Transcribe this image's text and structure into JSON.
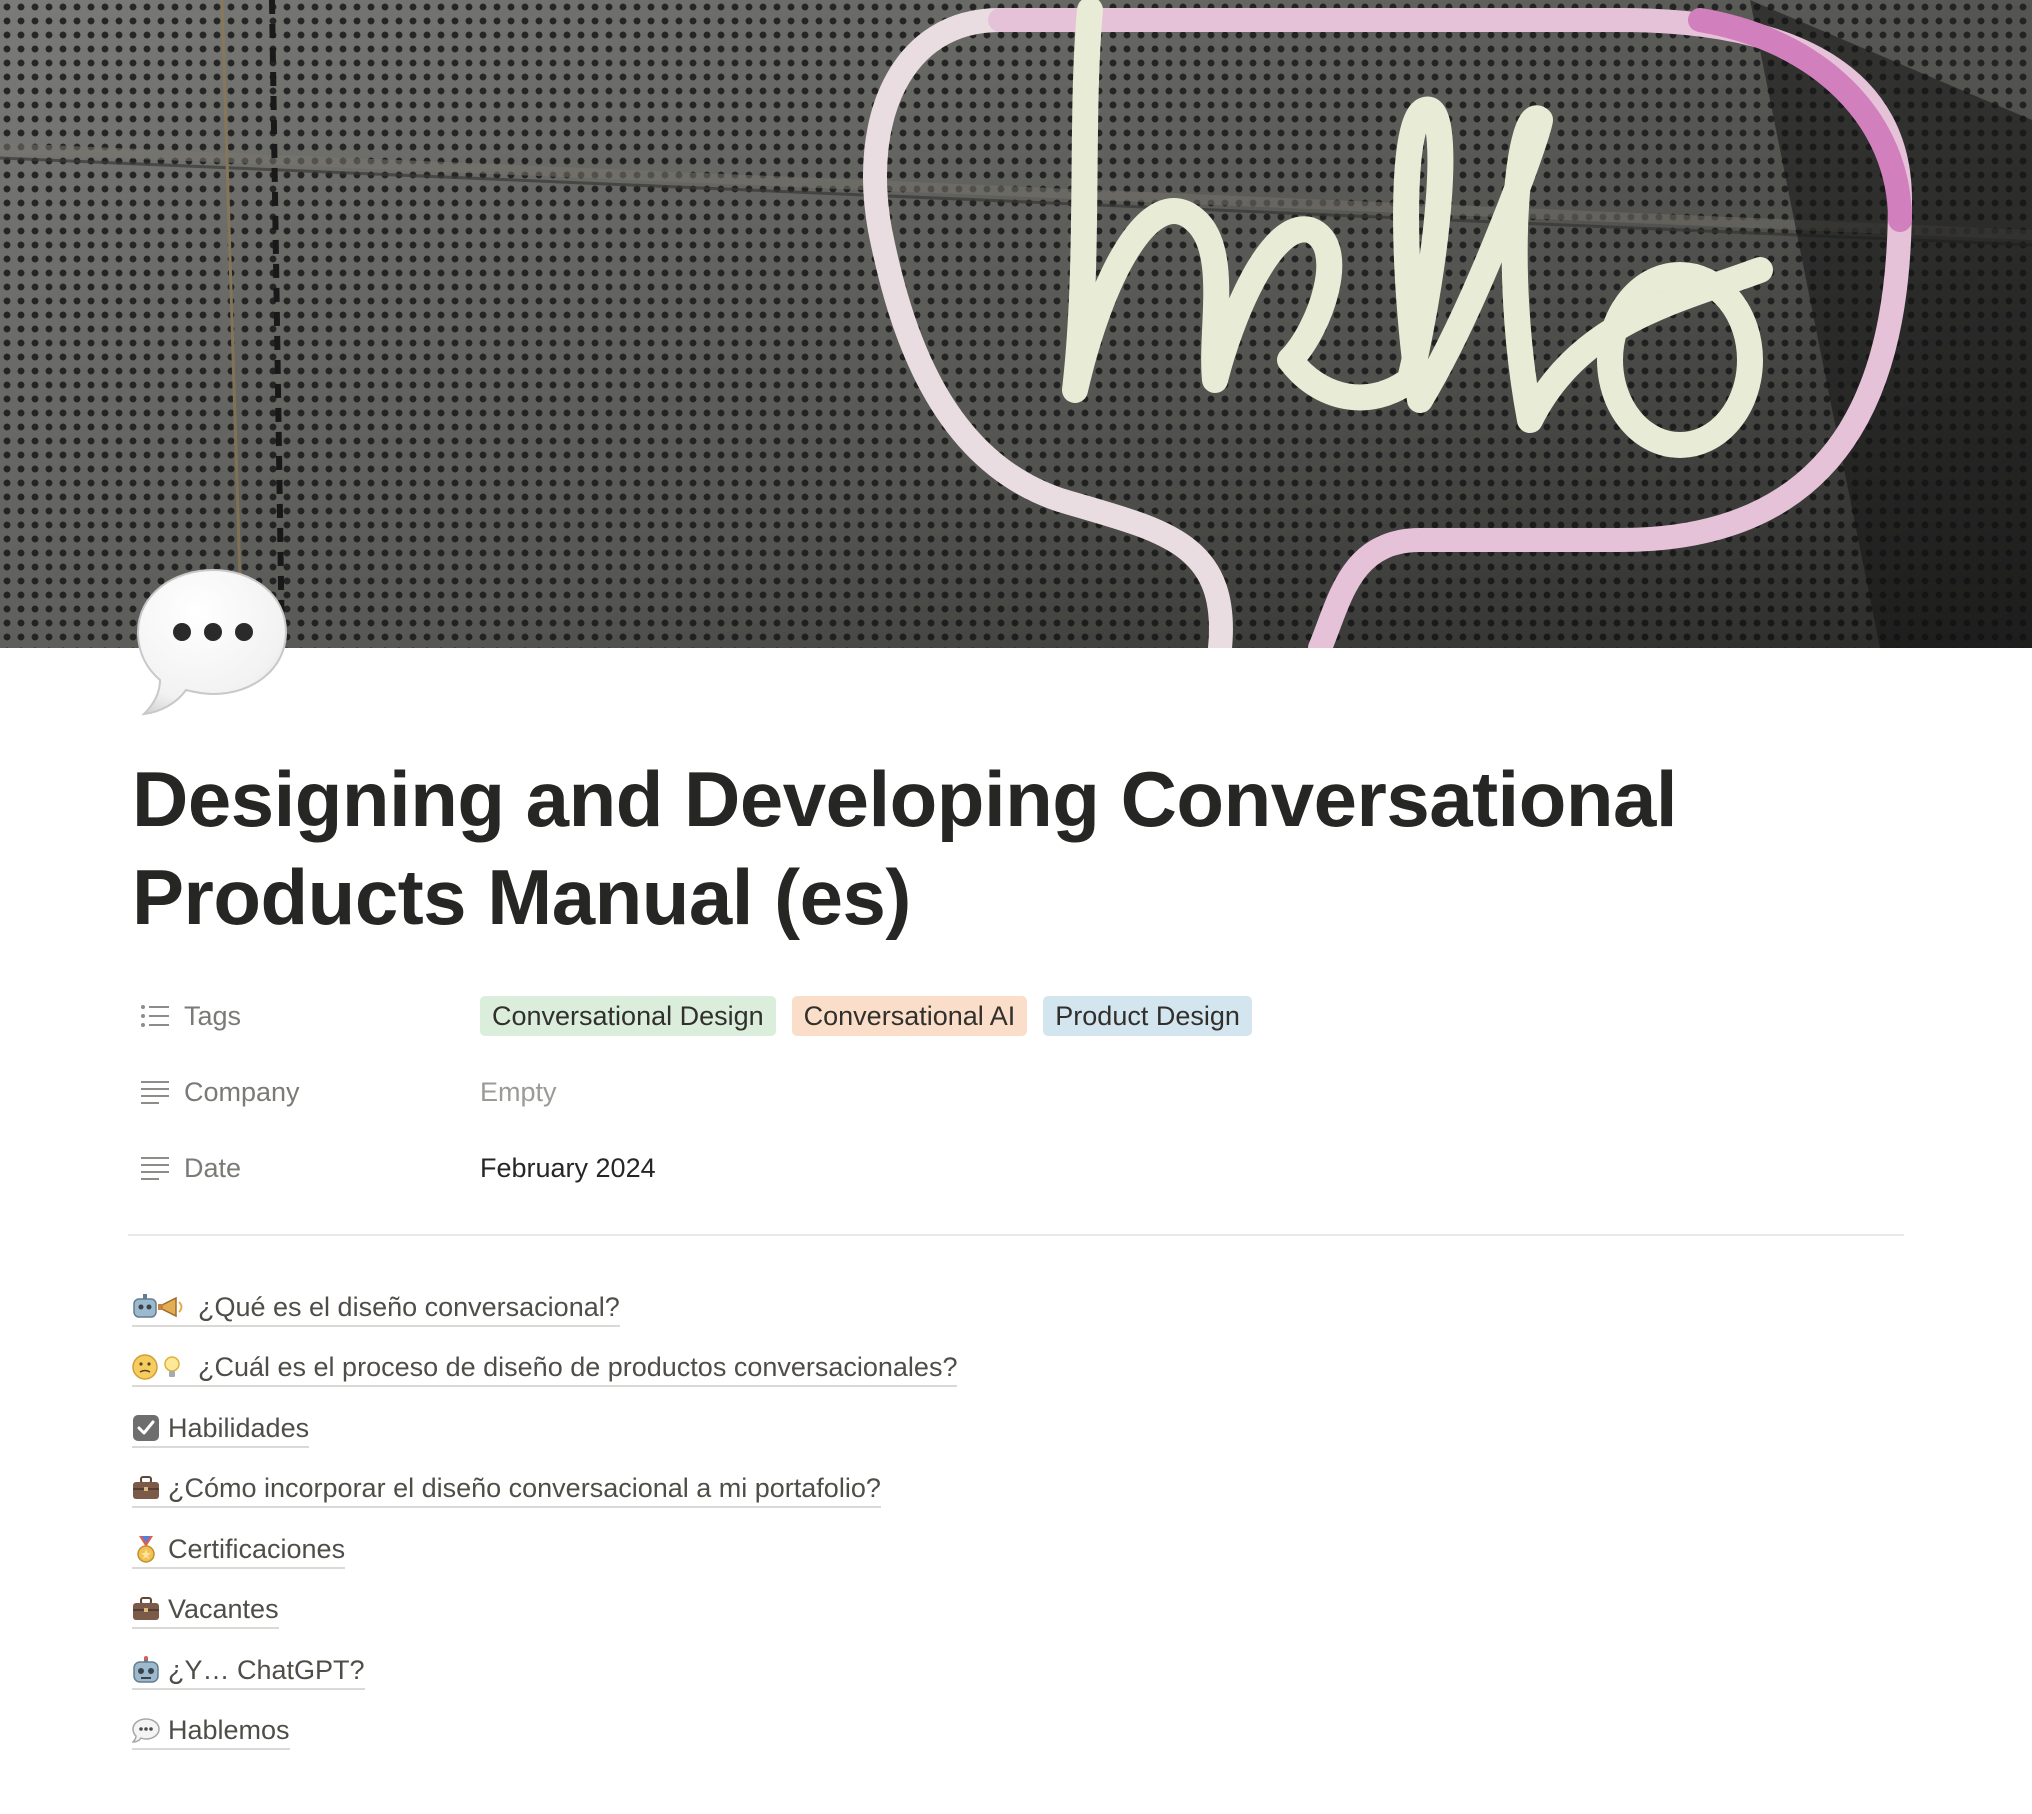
{
  "cover": {
    "image_text": "hello"
  },
  "page": {
    "icon": "speech-balloon-icon",
    "title": "Designing and Developing Conversational Products Manual (es)"
  },
  "properties": {
    "tags": {
      "label": "Tags",
      "icon": "list-icon",
      "values": [
        {
          "label": "Conversational Design",
          "color": "#dbeddb"
        },
        {
          "label": "Conversational AI",
          "color": "#fadec9"
        },
        {
          "label": "Product Design",
          "color": "#d3e5ef"
        }
      ]
    },
    "company": {
      "label": "Company",
      "icon": "text-lines-icon",
      "value": "Empty"
    },
    "date": {
      "label": "Date",
      "icon": "text-lines-icon",
      "value": "February 2024"
    }
  },
  "links": [
    {
      "emoji": "robot-megaphone-icon",
      "label": "¿Qué es el diseño conversacional?"
    },
    {
      "emoji": "thinking-bulb-icon",
      "label": "¿Cuál es el proceso de diseño de productos conversacionales?"
    },
    {
      "emoji": "checkbox-icon",
      "label": "Habilidades"
    },
    {
      "emoji": "briefcase-icon",
      "label": "¿Cómo incorporar el diseño conversacional a mi portafolio?"
    },
    {
      "emoji": "medal-icon",
      "label": "Certificaciones"
    },
    {
      "emoji": "briefcase-icon",
      "label": "Vacantes"
    },
    {
      "emoji": "robot-icon",
      "label": "¿Y… ChatGPT?"
    },
    {
      "emoji": "speech-balloon-icon",
      "label": "Hablemos"
    }
  ]
}
